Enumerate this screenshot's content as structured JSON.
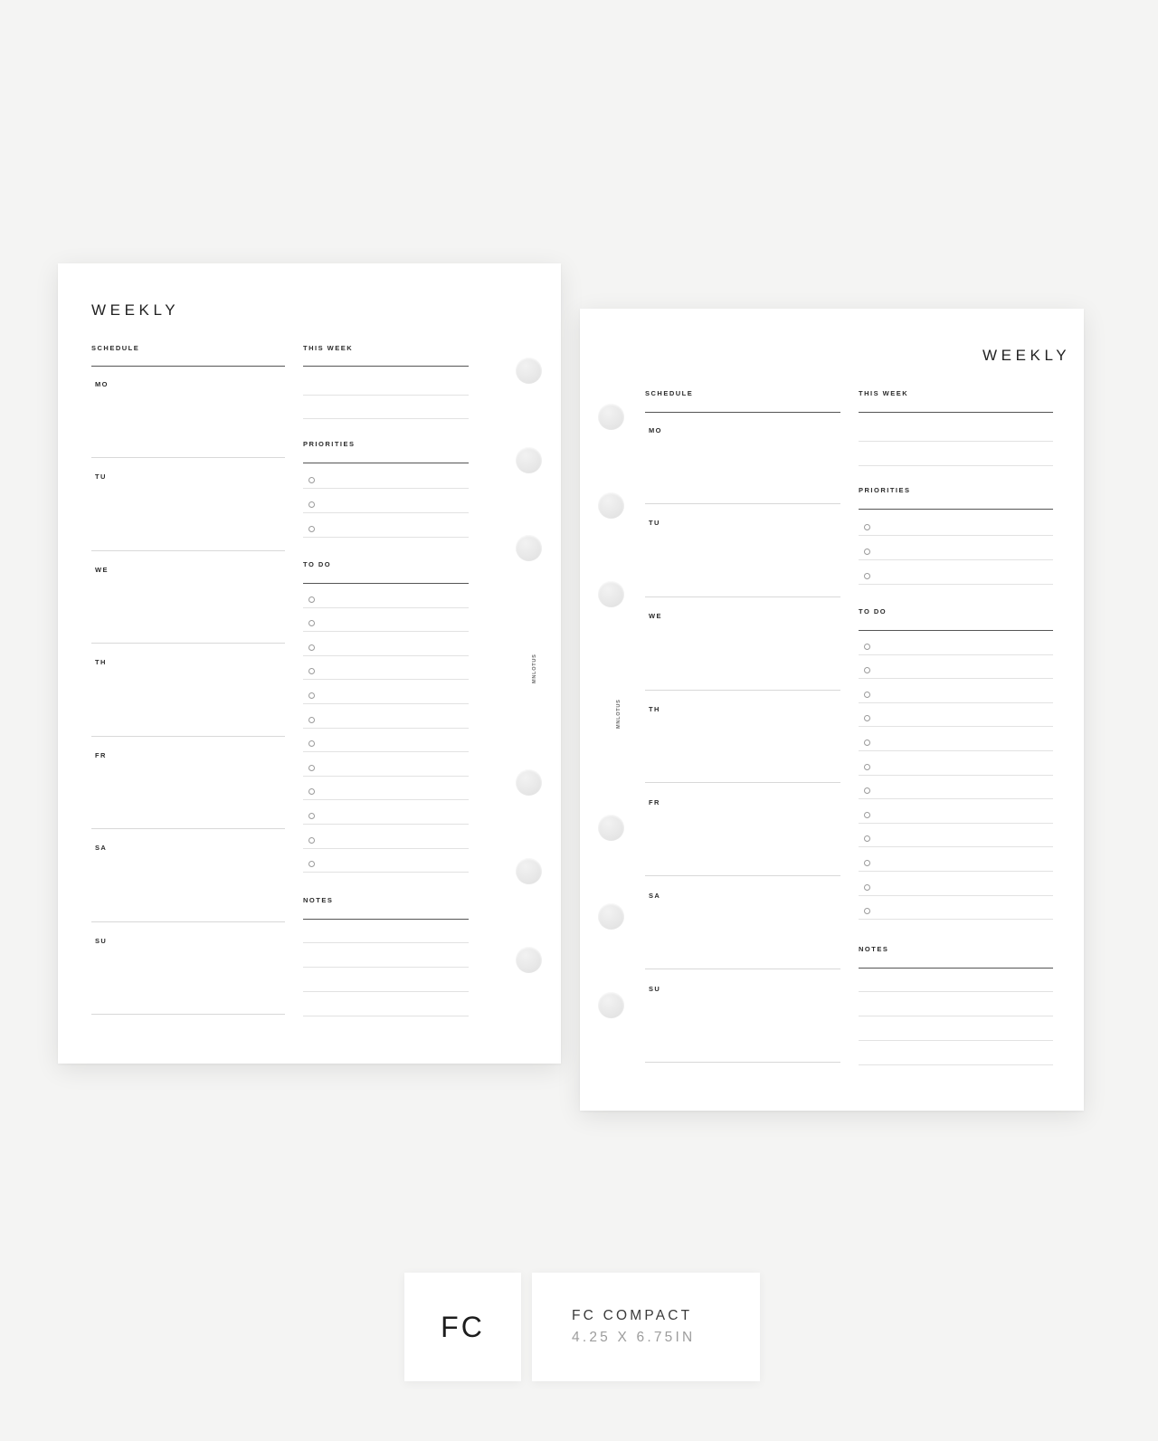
{
  "background_color": "#f4f4f3",
  "pages": [
    {
      "id": "left",
      "title": "WEEKLY",
      "title_align": "left",
      "brand": "MNLOTUS",
      "schedule": {
        "heading": "SCHEDULE",
        "days": [
          "MO",
          "TU",
          "WE",
          "TH",
          "FR",
          "SA",
          "SU"
        ]
      },
      "this_week": {
        "heading": "THIS WEEK",
        "line_count": 3
      },
      "priorities": {
        "heading": "PRIORITIES",
        "item_count": 3
      },
      "todo": {
        "heading": "TO DO",
        "item_count": 12
      },
      "notes": {
        "heading": "NOTES",
        "line_count": 5
      },
      "punch_holes": 6
    },
    {
      "id": "right",
      "title": "WEEKLY",
      "title_align": "right",
      "brand": "MNLOTUS",
      "schedule": {
        "heading": "SCHEDULE",
        "days": [
          "MO",
          "TU",
          "WE",
          "TH",
          "FR",
          "SA",
          "SU"
        ]
      },
      "this_week": {
        "heading": "THIS WEEK",
        "line_count": 3
      },
      "priorities": {
        "heading": "PRIORITIES",
        "item_count": 3
      },
      "todo": {
        "heading": "TO DO",
        "item_count": 12
      },
      "notes": {
        "heading": "NOTES",
        "line_count": 5
      },
      "punch_holes": 6
    }
  ],
  "badge": {
    "logo": "FC",
    "size_name": "FC COMPACT",
    "size_dims": "4.25 X 6.75IN"
  }
}
